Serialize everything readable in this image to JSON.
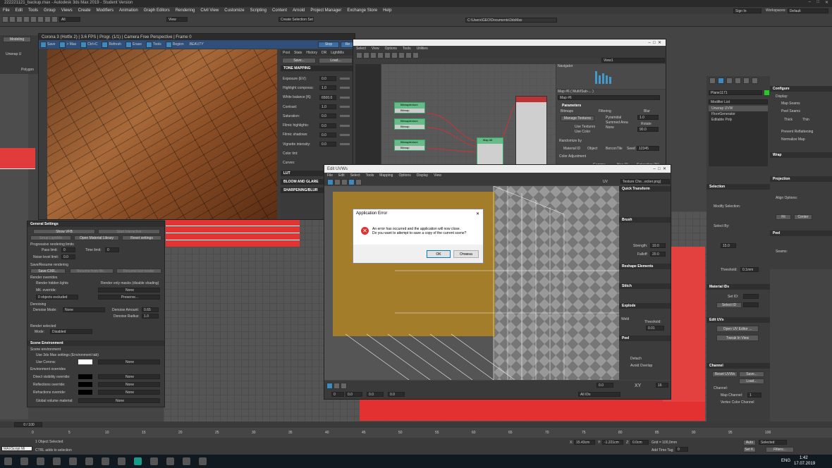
{
  "titlebar": {
    "title": "222221121_backup.max - Autodesk 3ds Max 2019 - Student Version"
  },
  "menu": {
    "items": [
      "File",
      "Edit",
      "Tools",
      "Group",
      "Views",
      "Create",
      "Modifiers",
      "Animation",
      "Graph Editors",
      "Rendering",
      "Civil View",
      "Customize",
      "Scripting",
      "Content",
      "Arnold",
      "Project Manager",
      "Exchange Store",
      "Help"
    ],
    "signin": "Sign In",
    "workspaces_label": "Workspaces:",
    "workspace_value": "Default"
  },
  "toolbar": {
    "filter": "All",
    "view": "View",
    "selection_set": "Create Selection Set",
    "path": "C:\\Users\\GEO\\Documents\\3dsMax"
  },
  "ribbon": {
    "tab": "Modeling",
    "unwrap": "Unwrap U",
    "polygon": "Polygon"
  },
  "vfb": {
    "title": "Corona 3 (Hotfix 2) | 3.6 FPS | Progr. (1/1) | Camera Free Perspective | Frame 0",
    "toolbar": [
      "Save",
      "> Max",
      "Ctrl+C",
      "Refresh",
      "Erase",
      "Tools",
      "Region"
    ],
    "beauty": "BEAUTY",
    "stop": "Stop",
    "render": "Re",
    "tabs": [
      "Post",
      "Stats",
      "History",
      "DR",
      "LightMix"
    ],
    "save_btn": "Save...",
    "load_btn": "Load...",
    "tone_mapping": "TONE MAPPING",
    "params": [
      {
        "label": "Exposure (EV):",
        "value": "0.0"
      },
      {
        "label": "Highlight compress:",
        "value": "1.0"
      },
      {
        "label": "White balance [K]:",
        "value": "6500.0"
      },
      {
        "label": "Contrast:",
        "value": "1.0"
      },
      {
        "label": "Saturation:",
        "value": "0.0"
      },
      {
        "label": "Filmic highlights:",
        "value": "0.0"
      },
      {
        "label": "Filmic shadows:",
        "value": "0.0"
      },
      {
        "label": "Vignette intensity:",
        "value": "0.0"
      },
      {
        "label": "Color tint:",
        "value": ""
      },
      {
        "label": "Curves:",
        "value": ""
      }
    ],
    "sections": [
      "LUT",
      "BLOOM AND GLARE",
      "SHARPENING/BLUR"
    ]
  },
  "render_settings": {
    "general": "General Settings",
    "show_vfb": "Show VFB",
    "start_interactive": "Start Interactive",
    "setup_lightmix": "Setup LightMix",
    "open_material_library": "Open Material Library",
    "reset_settings": "Reset settings",
    "progressive": "Progressive rendering limits",
    "pass_limit": "Pass limit:",
    "pass_value": "0",
    "time_limit": "Time limit:",
    "time_value": "0",
    "noise_limit": "Noise level limit:",
    "noise_value": "0.0",
    "save_resume": "Save/Resume rendering",
    "save_cxr": "Save CXR...",
    "resume_from_file": "Resume from file...",
    "resume_last": "Resume last render",
    "render_overrides": "Render overrides",
    "render_hidden": "Render hidden lights",
    "render_masks": "Render only masks (disable shading)",
    "mtl_override": "Mtl. override:",
    "none": "None",
    "excluded": "0 objects excluded",
    "preserve": "Preserve...",
    "denoising": "Denoising",
    "denoise_mode": "Denoise Mode:",
    "denoise_mode_value": "None",
    "denoise_amount": "Denoise Amount:",
    "denoise_amount_value": "0.65",
    "denoise_radius": "Denoise Radius:",
    "denoise_radius_value": "1.0",
    "render_selected": "Render selected",
    "mode": "Mode:",
    "mode_value": "Disabled",
    "scene_env": "Scene Environment",
    "scene_env_sub": "Scene environment",
    "use_max": "Use 3ds Max settings (Environment tab)",
    "use_corona": "Use Corona:",
    "env_overrides": "Environment overrides",
    "overrides": [
      "Direct visibility override:",
      "Reflections override:",
      "Refractions override:"
    ],
    "global_volume": "Global volume material:"
  },
  "slate": {
    "menu": [
      "Select",
      "View",
      "Options",
      "Tools",
      "Utilities"
    ],
    "view1": "View1",
    "navigator": "Navigator",
    "map_header": "Map #6  ( Multi/Sub-... )",
    "map_name": "Map #6",
    "parameters": "Parameters",
    "bitmaps": "Bitmaps",
    "manage_textures": "Manage Textures",
    "use_textures": "Use Textures",
    "use_color": "Use Color",
    "filtering": "Filtering",
    "pyramidal": "Pyramidal",
    "summed_area": "Summed Area",
    "filt_none": "None",
    "blur": "Blur",
    "blur_value": "1.0",
    "rotate": "Rotate",
    "rotate_value": "90.0",
    "randomize": "Randomize by",
    "material_id": "Material ID",
    "object": "Object",
    "bercon": "BerconTile",
    "seed": "Seed",
    "seed_value": "12345",
    "color_adj": "Color Adjustment",
    "gamma": "Gamma",
    "hue": "Hue (°)",
    "sat": "Saturation (%)",
    "bitmap_node": "Bitmaptexture",
    "bitmap_sub": "Bitmap",
    "multi_node": "Map #6\nMulti/Sub..."
  },
  "unwrap": {
    "title": "Edit UVWs",
    "menu": [
      "File",
      "Edit",
      "Select",
      "Tools",
      "Mapping",
      "Options",
      "Display",
      "View"
    ],
    "texture": "Texture Che...ecker.png)",
    "uv": "UV",
    "quick_transform": "Quick Transform",
    "brush": "Brush",
    "strength": "Strength:",
    "strength_value": "10.0",
    "falloff": "Falloff:",
    "falloff_value": "20.0",
    "reshape": "Reshape Elements",
    "stitch": "Stitch",
    "explode": "Explode",
    "weld": "Weld",
    "threshold": "Threshold:",
    "threshold_value": "0.01",
    "peel": "Peel",
    "detach": "Detach",
    "avoid_overlap": "Avoid Overlap",
    "bottom_u": "0.0",
    "bottom_v": "0.0",
    "bottom_w": "0.0",
    "all_ids": "All IDs",
    "zoom": "0.0",
    "xy": "XY",
    "count": "16"
  },
  "dialog": {
    "title": "Application Error",
    "message1": "An error has occurred and the application will now close.",
    "message2": "Do you want to attempt to save a copy of the current scene?",
    "ok": "OK",
    "cancel": "Отмена"
  },
  "modify": {
    "object_name": "Plane1171",
    "modifier_list": "Modifier List",
    "stack": [
      "Unwrap UVW",
      "FloorGenerator",
      "Editable Poly"
    ],
    "selection": "Selection",
    "modify_selection": "Modify Selection:",
    "select_by": "Select By:",
    "angle": "15.0",
    "threshold": "Threshold:",
    "threshold_value": "0.1mm",
    "material_ids": "Material IDs",
    "set_id": "Set ID:",
    "select_id": "Select ID",
    "edit_uvs": "Edit UVs",
    "open_uv_editor": "Open UV Editor ...",
    "tweak": "Tweak In View",
    "channel": "Channel",
    "reset_uvws": "Reset UVWs",
    "save": "Save...",
    "load": "Load...",
    "channel_label": "Channel:",
    "map_channel": "Map Channel:",
    "map_channel_value": "1",
    "vertex_color": "Vertex Color Channel"
  },
  "uv_panel": {
    "configure": "Configure",
    "display": "Display:",
    "map_seams": "Map Seams",
    "peel_seams": "Peel Seams",
    "thick": "Thick",
    "thin": "Thin",
    "prevent": "Prevent Reflattening",
    "normalize": "Normalize Map",
    "wrap": "Wrap",
    "projection": "Projection",
    "align": "Align Options:",
    "fit": "Fit",
    "center": "Center",
    "peel": "Peel",
    "seams": "Seams:"
  },
  "status": {
    "frame": "0 / 100",
    "selected": "1 Object Selected",
    "hint": "CTRL adds to selection",
    "maxscript": "MAXScript Mi",
    "x": "X:",
    "x_val": "15.43cm",
    "y": "Y:",
    "y_val": "-1.221cm",
    "z": "Z:",
    "z_val": "0.0cm",
    "grid": "Grid = 100,0mm",
    "add_time_tag": "Add Time Tag",
    "auto": "Auto",
    "set_k": "Set K.",
    "selected_label": "Selected",
    "filters": "Filters...",
    "frame_num": "0"
  },
  "taskbar": {
    "lang": "ENG",
    "time": "1:42",
    "date": "17.07.2019"
  },
  "timeline_ticks": [
    "0",
    "5",
    "10",
    "15",
    "20",
    "25",
    "30",
    "35",
    "40",
    "45",
    "50",
    "55",
    "60",
    "65",
    "70",
    "75",
    "80",
    "85",
    "90",
    "95",
    "100"
  ]
}
